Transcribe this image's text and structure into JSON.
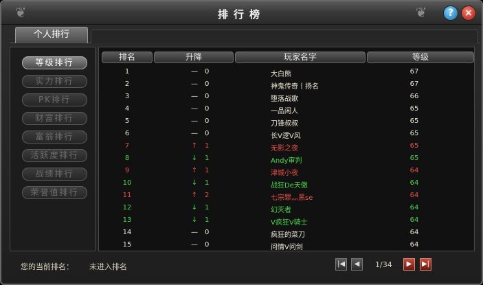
{
  "window": {
    "title": "排行榜",
    "help": "?",
    "close": "×"
  },
  "tab": {
    "label": "个人排行"
  },
  "sidebar": [
    {
      "label": "等级排行",
      "active": true
    },
    {
      "label": "实力排行",
      "active": false
    },
    {
      "label": "PK排行",
      "active": false
    },
    {
      "label": "财富排行",
      "active": false
    },
    {
      "label": "富翁排行",
      "active": false
    },
    {
      "label": "活跃度排行",
      "active": false
    },
    {
      "label": "战绩排行",
      "active": false
    },
    {
      "label": "荣誉值排行",
      "active": false
    }
  ],
  "table": {
    "headers": {
      "rank": "排名",
      "change": "升降",
      "name": "玩家名字",
      "level": "等级"
    },
    "rows": [
      {
        "rank": "1",
        "arrow": "—",
        "change": "0",
        "name": "大白熊",
        "level": "67",
        "color": "white"
      },
      {
        "rank": "2",
        "arrow": "—",
        "change": "0",
        "name": "神鬼传奇丨扬名",
        "level": "67",
        "color": "white"
      },
      {
        "rank": "3",
        "arrow": "—",
        "change": "0",
        "name": "堕落战歌",
        "level": "66",
        "color": "white"
      },
      {
        "rank": "4",
        "arrow": "—",
        "change": "0",
        "name": "一品闲人",
        "level": "65",
        "color": "white"
      },
      {
        "rank": "5",
        "arrow": "—",
        "change": "0",
        "name": "刀锋叔叔",
        "level": "65",
        "color": "white"
      },
      {
        "rank": "6",
        "arrow": "—",
        "change": "0",
        "name": "长V逻V风",
        "level": "65",
        "color": "white"
      },
      {
        "rank": "7",
        "arrow": "↑",
        "change": "1",
        "name": "无影之夜",
        "level": "65",
        "color": "red"
      },
      {
        "rank": "8",
        "arrow": "↓",
        "change": "1",
        "name": "Andy审判",
        "level": "65",
        "color": "green"
      },
      {
        "rank": "9",
        "arrow": "↑",
        "change": "1",
        "name": "津城小夜",
        "level": "64",
        "color": "red"
      },
      {
        "rank": "10",
        "arrow": "↓",
        "change": "1",
        "name": "战狂De天傲",
        "level": "64",
        "color": "green"
      },
      {
        "rank": "11",
        "arrow": "↑",
        "change": "2",
        "name": "七宗罪灬黑se",
        "level": "64",
        "color": "red"
      },
      {
        "rank": "12",
        "arrow": "↓",
        "change": "1",
        "name": "幻灭者",
        "level": "64",
        "color": "green"
      },
      {
        "rank": "13",
        "arrow": "↓",
        "change": "1",
        "name": "V疯狂V骑士",
        "level": "64",
        "color": "green"
      },
      {
        "rank": "14",
        "arrow": "—",
        "change": "0",
        "name": "疯狂的菜刀",
        "level": "64",
        "color": "white"
      },
      {
        "rank": "15",
        "arrow": "—",
        "change": "0",
        "name": "问情V问剑",
        "level": "64",
        "color": "white"
      }
    ]
  },
  "footer": {
    "current_label": "您的当前排名：",
    "current_value": "未进入排名",
    "page": "1/34",
    "first": "|◀",
    "prev": "◀",
    "next": "▶",
    "last": "▶|"
  }
}
